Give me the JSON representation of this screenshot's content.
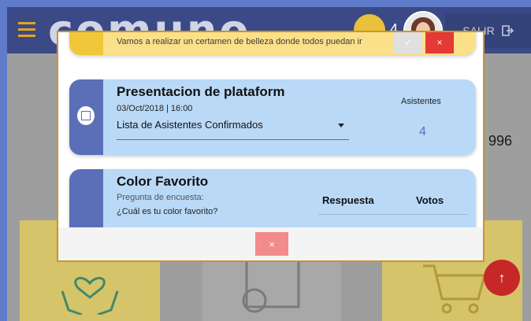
{
  "header": {
    "logo_text": "comuno",
    "coin_count": "4",
    "logout_label": "SALIR",
    "logout_icon": "logout-icon"
  },
  "background": {
    "side_number": "996",
    "fab_icon": "arrow-up-icon"
  },
  "modal": {
    "notice": {
      "text": "Vamos a realizar un certamen de belleza donde todos puedan ir",
      "confirm_icon": "check-icon",
      "reject_label": "×"
    },
    "event": {
      "title": "Presentacion de plataform",
      "date": "03/Oct/2018 | 16:00",
      "select_value": "Lista de Asistentes Confirmados",
      "attendees_label": "Asistentes",
      "attendees_count": "4",
      "icon": "calendar-icon"
    },
    "survey": {
      "title": "Color Favorito",
      "subtitle": "Pregunta de encuesta:",
      "question": "¿Cuál es tu color favorito?",
      "col_answer": "Respuesta",
      "col_votes": "Votos"
    },
    "close_label": "×"
  },
  "colors": {
    "accent_blue": "#5b6fb8",
    "card_blue": "#b9d9f7",
    "card_yellow": "#fbe08a",
    "danger": "#e53935",
    "modal_border": "#c8952d"
  }
}
